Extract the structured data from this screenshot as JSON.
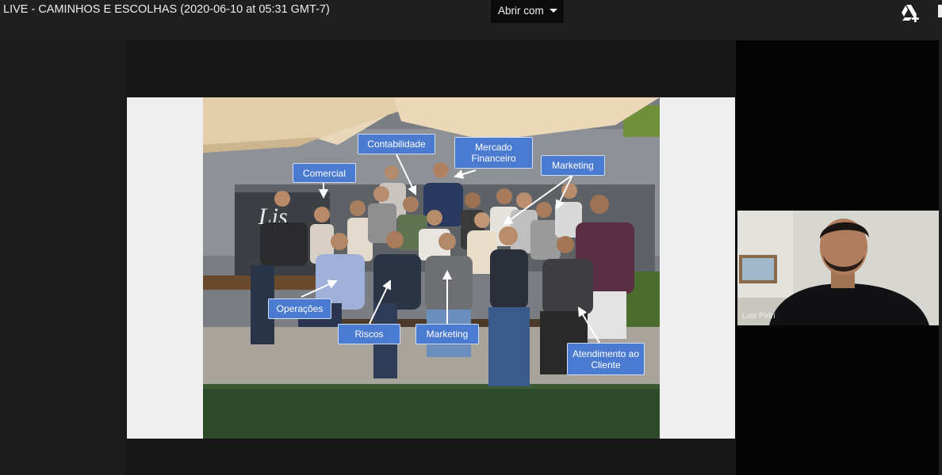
{
  "header": {
    "title": "LIVE - CAMINHOS E ESCOLHAS (2020-06-10 at 05:31 GMT-7)",
    "open_with_label": "Abrir com",
    "open_with_icon": "chevron-down-icon",
    "drive_icon": "google-drive-add-icon"
  },
  "slide": {
    "photo_labels": {
      "comercial": "Comercial",
      "contabilidade": "Contabilidade",
      "mercado_financeiro": "Mercado Financeiro",
      "marketing_top": "Marketing",
      "operacoes": "Operações",
      "riscos": "Riscos",
      "marketing_bottom": "Marketing",
      "atendimento": "Atendimento ao Cliente"
    },
    "background_sign": "Lis"
  },
  "webcam": {
    "participant_name": "Luiz Petri"
  },
  "colors": {
    "label_blue": "#4a7bd0",
    "topbar": "#1f1f1f",
    "slide_bg": "#efefef"
  }
}
